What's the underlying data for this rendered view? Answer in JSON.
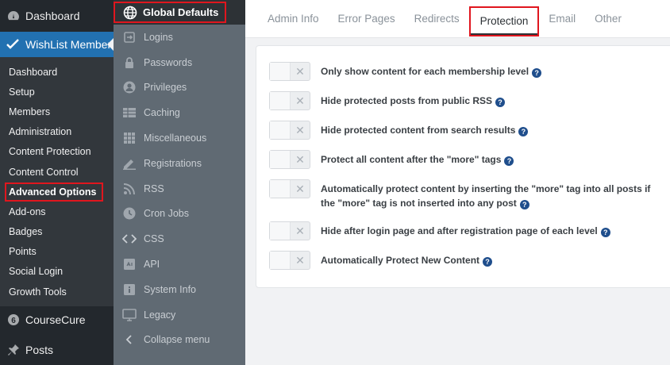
{
  "wp_menu": {
    "dashboard": "Dashboard",
    "wishlist_member": "WishList Member",
    "submenu": [
      {
        "label": "Dashboard"
      },
      {
        "label": "Setup"
      },
      {
        "label": "Members"
      },
      {
        "label": "Administration"
      },
      {
        "label": "Content Protection"
      },
      {
        "label": "Content Control"
      },
      {
        "label": "Advanced Options",
        "current": true
      },
      {
        "label": "Add-ons"
      },
      {
        "label": "Badges"
      },
      {
        "label": "Points"
      },
      {
        "label": "Social Login"
      },
      {
        "label": "Growth Tools"
      }
    ],
    "coursecure": "CourseCure",
    "posts": "Posts"
  },
  "wlm_menu": {
    "header": "Global Defaults",
    "items": [
      {
        "label": "Logins",
        "icon": "login-icon"
      },
      {
        "label": "Passwords",
        "icon": "lock-icon"
      },
      {
        "label": "Privileges",
        "icon": "user-icon"
      },
      {
        "label": "Caching",
        "icon": "table-icon"
      },
      {
        "label": "Miscellaneous",
        "icon": "grid-icon"
      },
      {
        "label": "Registrations",
        "icon": "pencil-icon"
      },
      {
        "label": "RSS",
        "icon": "rss-icon"
      },
      {
        "label": "Cron Jobs",
        "icon": "clock-icon"
      },
      {
        "label": "CSS",
        "icon": "code-icon"
      },
      {
        "label": "API",
        "icon": "api-icon"
      },
      {
        "label": "System Info",
        "icon": "info-icon"
      },
      {
        "label": "Legacy",
        "icon": "monitor-icon"
      },
      {
        "label": "Collapse menu",
        "icon": "chevron-left-icon"
      }
    ]
  },
  "tabs": [
    {
      "label": "Admin Info"
    },
    {
      "label": "Error Pages"
    },
    {
      "label": "Redirects"
    },
    {
      "label": "Protection",
      "active": true
    },
    {
      "label": "Email"
    },
    {
      "label": "Other"
    }
  ],
  "options": [
    {
      "line1": "Only show content for each membership level",
      "enabled": false
    },
    {
      "line1": "Hide protected posts from public RSS",
      "enabled": false
    },
    {
      "line1": "Hide protected content from search results",
      "enabled": false
    },
    {
      "line1": "Protect all content after the \"more\" tags",
      "enabled": false
    },
    {
      "line1": "Automatically protect content by inserting the \"more\" tag into all posts if the \"more\" tag is not inserted into any post",
      "enabled": false
    },
    {
      "line1": "Hide after login page and after registration page of each level",
      "enabled": false
    },
    {
      "line1": "Automatically Protect New Content",
      "enabled": false
    }
  ],
  "colors": {
    "wp_sidebar": "#23282d",
    "wp_active": "#2271b1",
    "highlight_red": "#e0161e",
    "help_blue": "#1f4e8c"
  }
}
